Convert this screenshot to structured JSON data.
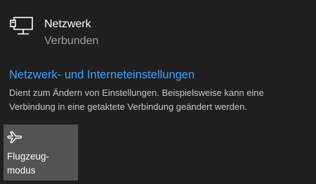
{
  "network": {
    "icon": "wired-network-icon",
    "name": "Netzwerk",
    "status": "Verbunden"
  },
  "settings": {
    "link_label": "Netzwerk- und Interneteinstellungen",
    "description": "Dient zum Ändern von Einstellungen. Beispielsweise kann eine Verbindung in eine getaktete Verbindung geändert werden."
  },
  "quick_actions": [
    {
      "icon": "airplane-icon",
      "label_line1": "Flugzeug-",
      "label_line2": "modus",
      "state": "off"
    }
  ],
  "colors": {
    "background": "#1f1f1f",
    "accent_link": "#3fa2ff",
    "tile_background": "#535353",
    "secondary_text": "#a0a0a0"
  }
}
